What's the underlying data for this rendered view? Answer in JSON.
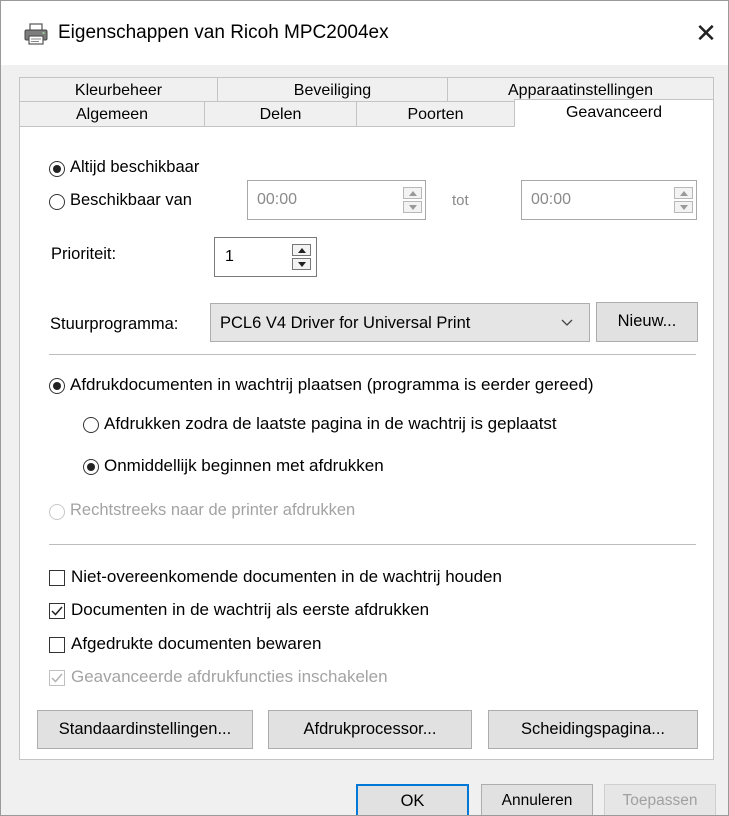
{
  "window": {
    "title": "Eigenschappen van Ricoh MPC2004ex",
    "close_glyph": "✕",
    "icon": "printer-icon"
  },
  "tabs": {
    "row1": [
      "Kleurbeheer",
      "Beveiliging",
      "Apparaatinstellingen"
    ],
    "row2": [
      "Algemeen",
      "Delen",
      "Poorten",
      "Geavanceerd"
    ],
    "active": "Geavanceerd"
  },
  "availability": {
    "always_label": "Altijd beschikbaar",
    "range_label": "Beschikbaar van",
    "from_value": "00:00",
    "to_label": "tot",
    "to_value": "00:00",
    "selected": "always"
  },
  "priority": {
    "label": "Prioriteit:",
    "value": "1"
  },
  "driver": {
    "label": "Stuurprogramma:",
    "selected": "PCL6 V4 Driver for Universal Print",
    "new_button": "Nieuw..."
  },
  "spooling": {
    "spool_label": "Afdrukdocumenten in wachtrij plaatsen (programma is eerder gereed)",
    "after_last_page_label": "Afdrukken zodra de laatste pagina in de wachtrij is geplaatst",
    "immediately_label": "Onmiddellijk beginnen met afdrukken",
    "direct_label": "Rechtstreeks naar de printer afdrukken"
  },
  "options": {
    "hold_mismatched": {
      "label": "Niet-overeenkomende documenten in de wachtrij houden",
      "checked": false
    },
    "spooled_first": {
      "label": "Documenten in de wachtrij als eerste afdrukken",
      "checked": true
    },
    "keep_printed": {
      "label": "Afgedrukte documenten bewaren",
      "checked": false
    },
    "advanced_features": {
      "label": "Geavanceerde afdrukfuncties inschakelen",
      "checked": true,
      "disabled": true
    }
  },
  "panel_buttons": {
    "defaults": "Standaardinstellingen...",
    "processor": "Afdrukprocessor...",
    "separator_page": "Scheidingspagina..."
  },
  "dialog_buttons": {
    "ok": "OK",
    "cancel": "Annuleren",
    "apply": "Toepassen"
  },
  "colors": {
    "accent": "#0078d7",
    "disabled_text": "#a3a3a3"
  }
}
